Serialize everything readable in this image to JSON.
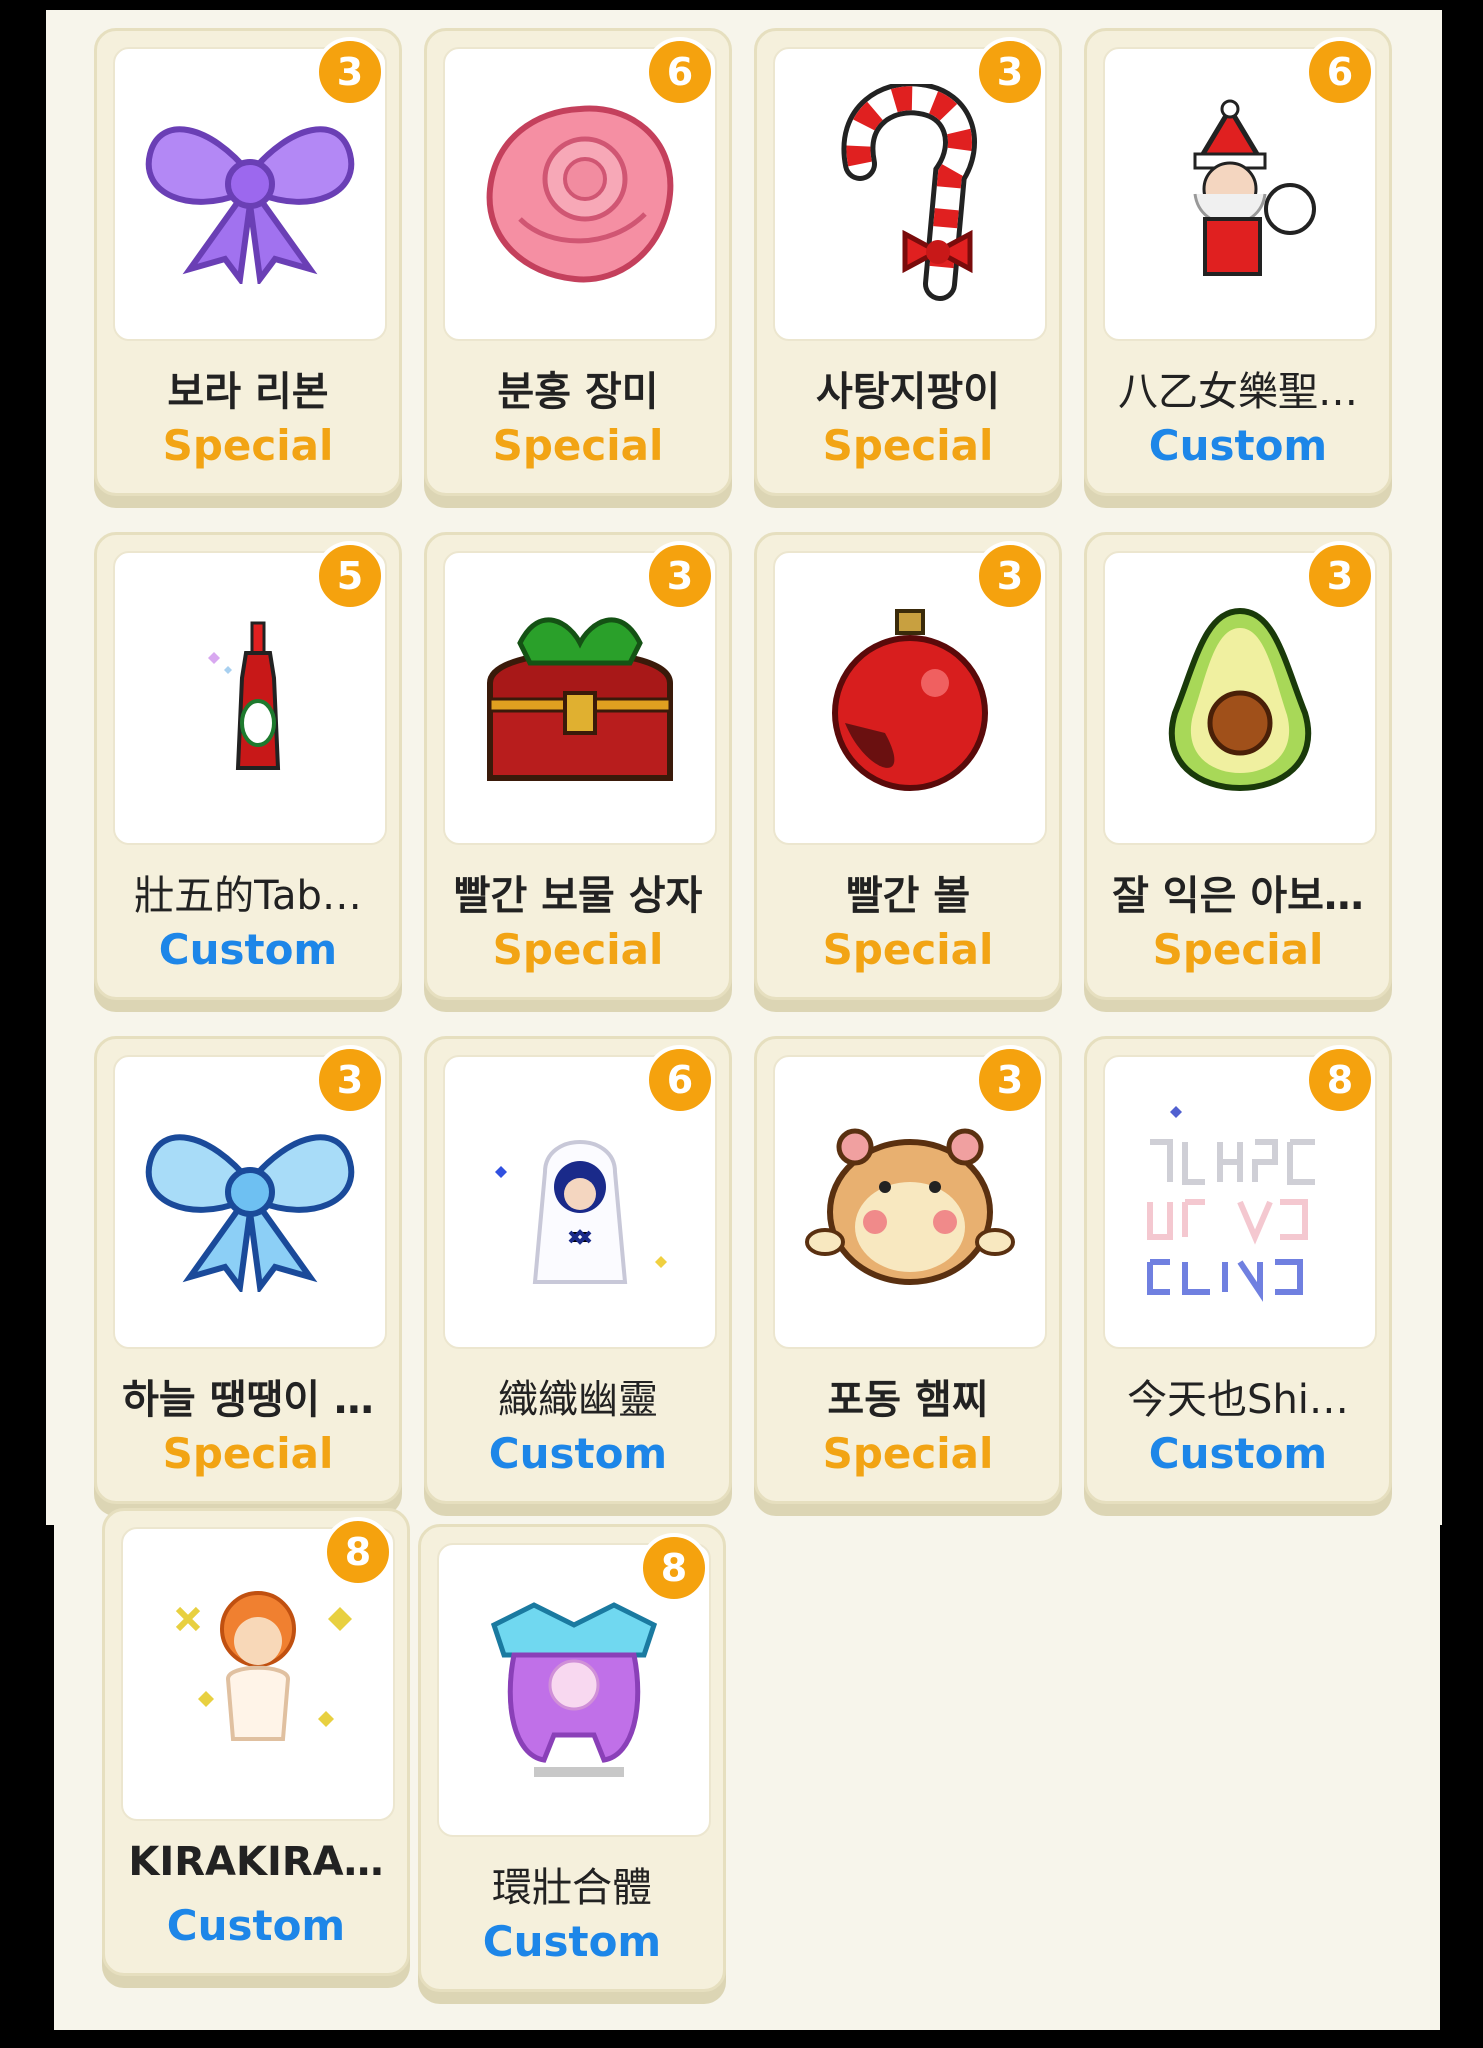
{
  "colors": {
    "background": "#f7f5eb",
    "badge": "#f5a20e",
    "special": "#f2a414",
    "custom": "#1d86e8"
  },
  "items": [
    {
      "name": "보라 리본",
      "type": "Special",
      "count": "3",
      "icon": "purple-ribbon-icon"
    },
    {
      "name": "분홍 장미",
      "type": "Special",
      "count": "6",
      "icon": "pink-rose-icon"
    },
    {
      "name": "사탕지팡이",
      "type": "Special",
      "count": "3",
      "icon": "candy-cane-icon"
    },
    {
      "name": "八乙女樂聖…",
      "type": "Custom",
      "count": "6",
      "icon": "santa-icon"
    },
    {
      "name": "壯五的Tab…",
      "type": "Custom",
      "count": "5",
      "icon": "tabasco-bottle-icon"
    },
    {
      "name": "빨간 보물 상자",
      "type": "Special",
      "count": "3",
      "icon": "treasure-chest-icon"
    },
    {
      "name": "빨간 볼",
      "type": "Special",
      "count": "3",
      "icon": "red-ornament-icon"
    },
    {
      "name": "잘 익은 아보…",
      "type": "Special",
      "count": "3",
      "icon": "avocado-icon"
    },
    {
      "name": "하늘 땡땡이 …",
      "type": "Special",
      "count": "3",
      "icon": "sky-ribbon-icon"
    },
    {
      "name": "織織幽靈",
      "type": "Custom",
      "count": "6",
      "icon": "ghost-character-icon"
    },
    {
      "name": "포동 햄찌",
      "type": "Special",
      "count": "3",
      "icon": "hamster-icon"
    },
    {
      "name": "今天也Shi…",
      "type": "Custom",
      "count": "8",
      "icon": "pixel-text-icon"
    },
    {
      "name": "KIRAKIRA…",
      "type": "Custom",
      "count": "8",
      "icon": "angel-character-icon"
    },
    {
      "name": "環壯合體",
      "type": "Custom",
      "count": "8",
      "icon": "purple-creature-icon"
    }
  ]
}
